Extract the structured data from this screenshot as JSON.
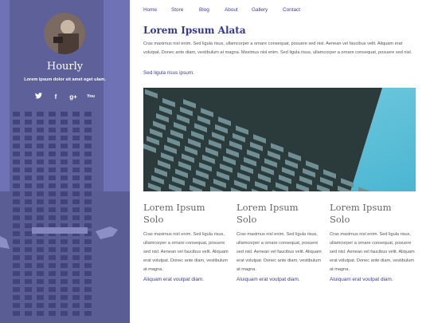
{
  "sidebar": {
    "site_title": "Hourly",
    "tagline": "Lorem ipsum dolor sit amet eget ulam.",
    "social": [
      {
        "icon": "twitter-icon",
        "glyph": "🐦"
      },
      {
        "icon": "facebook-icon",
        "glyph": "f"
      },
      {
        "icon": "google-plus-icon",
        "glyph": "g+"
      },
      {
        "icon": "youtube-icon",
        "glyph": "You"
      }
    ]
  },
  "nav": {
    "items": [
      "Home",
      "Store",
      "Blog",
      "About",
      "Gallery",
      "Contact"
    ]
  },
  "main": {
    "title": "Lorem Ipsum Alata",
    "paragraph": "Cras maximus nisl enim. Sed ligula risus, ullamcorper a ornare consequat, posuere sed nisl. Aenean vel faucibus velit. Aliquam erat volutpat. Donec ante diam, vestibulum at magna. Maximus nisl enim. Sed ligula risus, ullamcorper a ornare consequat, posuere sed nisl.",
    "link": "Sed ligula risus ipsum."
  },
  "columns": [
    {
      "title": "Lorem Ipsum Solo",
      "text": "Cras maximus nisl enim. Sed ligula risus, ullamcorper a ornare consequat, posuere sed nisl. Aenean vel faucibus velit. Aliquam erat volutpat. Donec ante diam, vestibulum at magna.",
      "link": "Aliquam erat voutpat diam."
    },
    {
      "title": "Lorem Ipsum Solo",
      "text": "Cras maximus nisl enim. Sed ligula risus, ullamcorper a ornare consequat, posuere sed nisl. Aenean vel faucibus velit. Aliquam erat volutpat. Donec ante diam, vestibulum at magna.",
      "link": "Aluiquam erat voutpat diam."
    },
    {
      "title": "Lorem Ipsum Solo",
      "text": "Cras maximus nisl enim. Sed ligula risus, ullamcorper a ornare consequat, posuere sed nisl. Aenean vel faucibus velit. Aliquam erat volutpat. Donec ante diam, vestibulum at magna.",
      "link": "Aluiquam erat voutpat diam."
    }
  ],
  "colors": {
    "sidebar": "#6f72b4",
    "accent": "#35388f",
    "sky": "#5cc0d6"
  }
}
